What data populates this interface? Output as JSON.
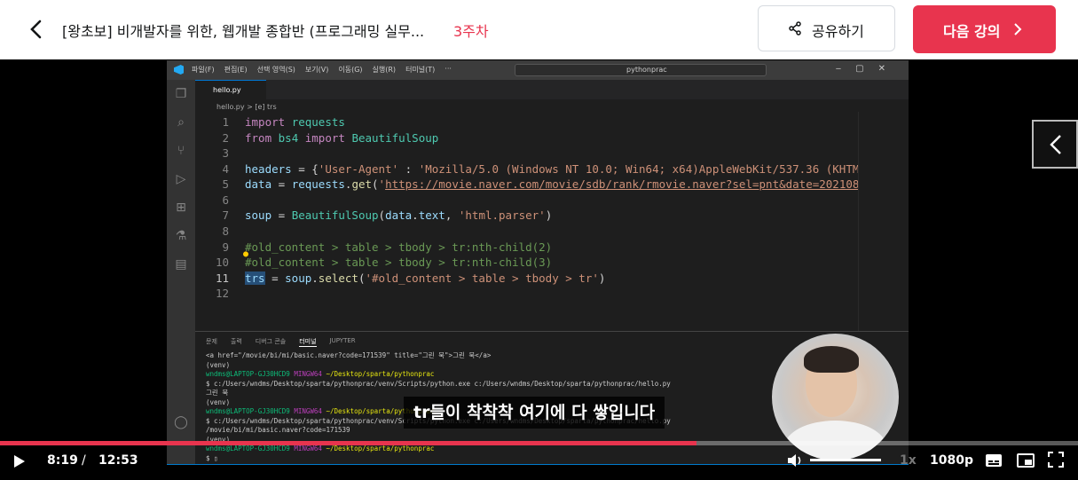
{
  "header": {
    "course_title": "[왕초보] 비개발자를 위한, 웹개발 종합반 (프로그래밍 실무...",
    "week": "3주차",
    "share_label": "공유하기",
    "next_label": "다음 강의"
  },
  "vscode": {
    "menu": [
      "파일(F)",
      "편집(E)",
      "선택 영역(S)",
      "보기(V)",
      "이동(G)",
      "실행(R)",
      "터미널(T)",
      "···"
    ],
    "search": "pythonprac",
    "tab": "hello.py",
    "breadcrumb": "hello.py > [e] trs",
    "code_lines": [
      "1",
      "2",
      "3",
      "4",
      "5",
      "6",
      "7",
      "8",
      "9",
      "10",
      "11",
      "12"
    ],
    "panel_tabs": [
      "문제",
      "출력",
      "디버그 콘솔",
      "터미널",
      "JUPYTER"
    ]
  },
  "subtitle": "tr들이 착착착 여기에 다 쌓입니다",
  "player": {
    "current_time": "8:19",
    "separator": "/",
    "duration": "12:53",
    "progress_fraction": 0.646,
    "speed": "1x",
    "quality": "1080p"
  },
  "colors": {
    "accent": "#e8344e",
    "vscode_blue": "#007acc"
  },
  "icons": [
    "back-chevron-icon",
    "share-icon",
    "next-chevron-icon",
    "play-icon",
    "volume-icon",
    "captions-icon",
    "pip-icon",
    "fullscreen-icon"
  ]
}
